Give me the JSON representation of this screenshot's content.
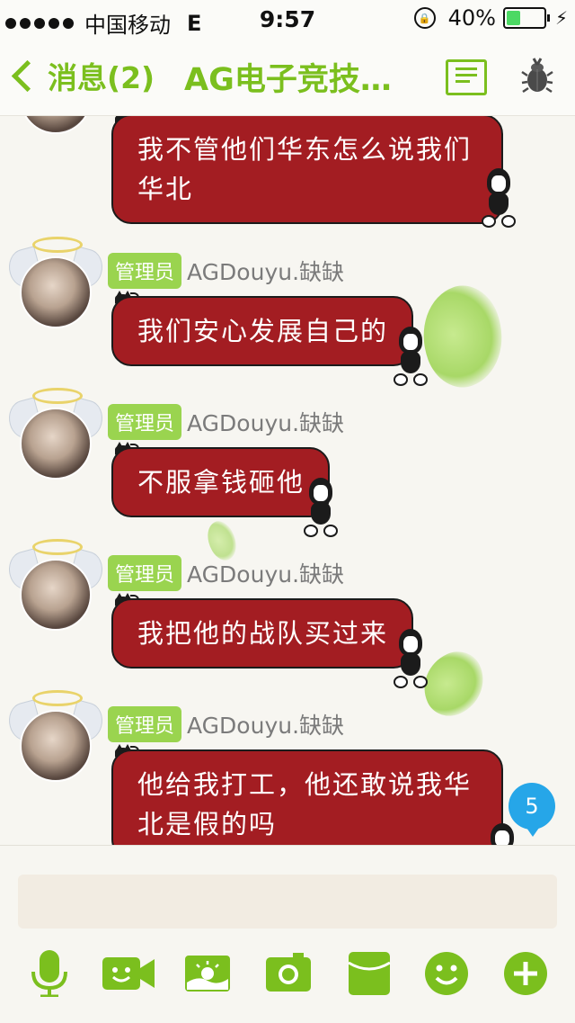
{
  "status_bar": {
    "carrier": "中国移动",
    "network": "E",
    "time": "9:57",
    "battery": "40%",
    "battery_level": 0.4
  },
  "nav": {
    "back_label": "消息(2)",
    "title": "AG电子竞技…",
    "menu_icon": "list-icon",
    "profile_icon": "beetle-icon"
  },
  "messages": [
    {
      "badge": "",
      "sender": "",
      "text_lines": [
        "我不管他们华东怎么说我们",
        "华北"
      ]
    },
    {
      "badge": "管理员",
      "sender": "AGDouyu.缺缺",
      "text_lines": [
        "我们安心发展自己的"
      ]
    },
    {
      "badge": "管理员",
      "sender": "AGDouyu.缺缺",
      "text_lines": [
        "不服拿钱砸他"
      ]
    },
    {
      "badge": "管理员",
      "sender": "AGDouyu.缺缺",
      "text_lines": [
        "我把他的战队买过来"
      ]
    },
    {
      "badge": "管理员",
      "sender": "AGDouyu.缺缺",
      "text_lines": [
        "他给我打工，他还敢说我华",
        "北是假的吗"
      ]
    }
  ],
  "unread_count": "5",
  "input": {
    "placeholder": ""
  },
  "toolbar": [
    "microphone-icon",
    "video-call-icon",
    "image-icon",
    "camera-icon",
    "pocket-icon",
    "emoji-icon",
    "plus-icon"
  ],
  "colors": {
    "accent": "#7bbf1e",
    "bubble": "#a31d22",
    "badge": "#9ad44f",
    "unread": "#26a6e8"
  }
}
